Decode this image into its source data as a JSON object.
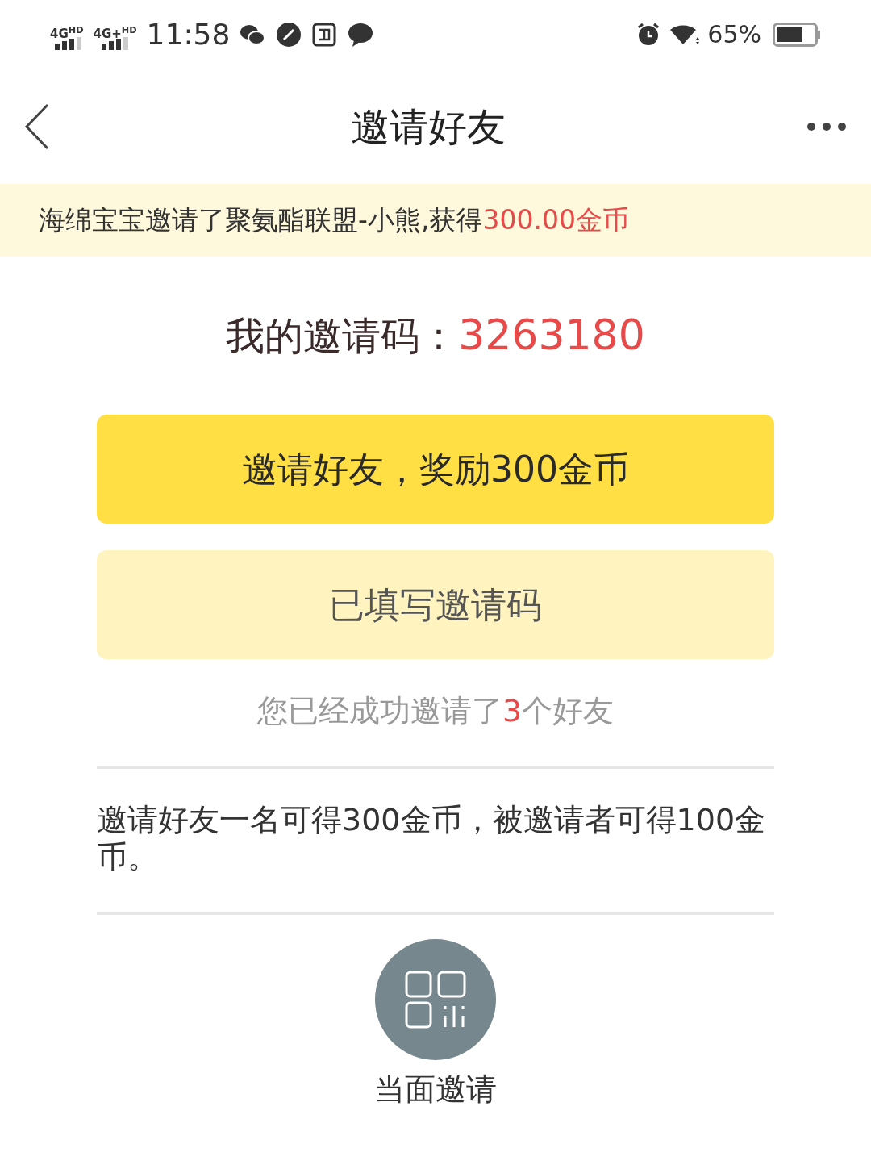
{
  "status_bar": {
    "sim1": "4G$^{HD}$",
    "sim2": "4G+$^{HD}$",
    "time": "11:58",
    "battery": "65%"
  },
  "header": {
    "title": "邀请好友"
  },
  "banner": {
    "text": "海绵宝宝邀请了聚氨酯联盟-小熊,获得",
    "highlight": "300.00金币"
  },
  "invite_code": {
    "label": "我的邀请码：",
    "code": "3263180"
  },
  "buttons": [
    {
      "label": "邀请好友，奖励300金币",
      "kind": "primary"
    },
    {
      "label": "已填写邀请码",
      "kind": "soft"
    }
  ],
  "invited": {
    "before": "您已经成功邀请了",
    "count": "3",
    "after": "个好友"
  },
  "rules": "邀请好友一名可得300金币，被邀请者可得100金币。",
  "face_to_face": {
    "label": "当面邀请"
  }
}
